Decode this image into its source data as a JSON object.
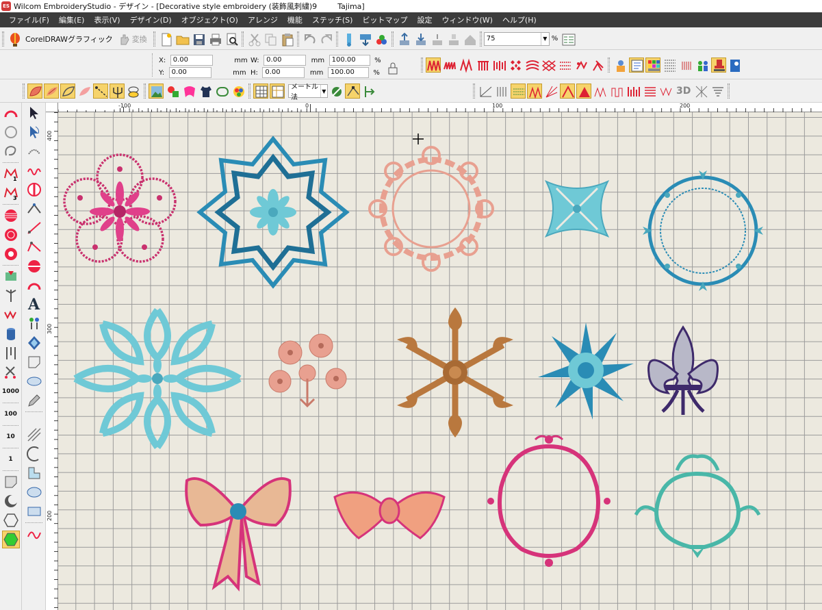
{
  "window": {
    "app_icon": "ES",
    "title": "Wilcom EmbroideryStudio - デザイン - [Decorative style embroidery (装飾風刺繍)9",
    "machine": "Tajima]"
  },
  "menu": [
    "ファイル(F)",
    "編集(E)",
    "表示(V)",
    "デザイン(D)",
    "オブジェクト(O)",
    "アレンジ",
    "機能",
    "ステッチ(S)",
    "ビットマップ",
    "設定",
    "ウィンドウ(W)",
    "ヘルプ(H)"
  ],
  "toolbar1": {
    "coreldraw_label": "CorelDRAWグラフィック",
    "convert_label": "変換",
    "zoom_value": "75",
    "zoom_unit": "%"
  },
  "position": {
    "x_label": "X:",
    "x_value": "0.00",
    "x_unit": "mm",
    "y_label": "Y:",
    "y_value": "0.00",
    "y_unit": "mm",
    "w_label": "W:",
    "w_value": "0.00",
    "w_unit": "mm",
    "h_label": "H:",
    "h_value": "0.00",
    "h_unit": "mm",
    "sx_value": "100.00",
    "sx_unit": "%",
    "sy_value": "100.00",
    "sy_unit": "%"
  },
  "toolbar3": {
    "measure_mode": "メートル法",
    "three_d": "3D"
  },
  "rulers": {
    "h_ticks": [
      "-100",
      "0",
      "100",
      "200"
    ],
    "v_ticks": [
      "400",
      "300",
      "200"
    ]
  },
  "left_toolbar": {
    "label_1000": "1000",
    "label_100": "100",
    "label_10": "10",
    "label_1": "1",
    "text_tool": "A"
  },
  "colors": {
    "pink": "#d6337a",
    "teal": "#2b8fb8",
    "light_teal": "#6fc9d6",
    "peach": "#e8a090",
    "bronze": "#b9783e",
    "mint": "#49b7a8",
    "navy": "#3e2a6b"
  }
}
